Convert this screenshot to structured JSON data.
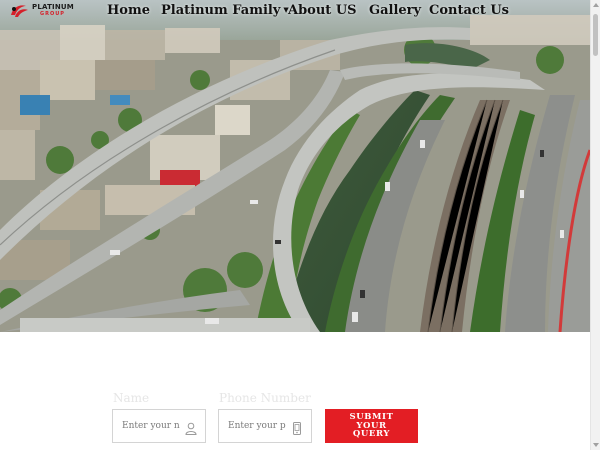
{
  "brand": {
    "name_line1": "PLATINUM",
    "name_line2": "GROUP",
    "accent_color": "#e31e24"
  },
  "nav": {
    "items": [
      {
        "label": "Home",
        "has_dropdown": false
      },
      {
        "label": "Platinum Family",
        "has_dropdown": true
      },
      {
        "label": "About US",
        "has_dropdown": false
      },
      {
        "label": "Gallery",
        "has_dropdown": false
      },
      {
        "label": "Contact Us",
        "has_dropdown": false
      }
    ],
    "dropdown_icon": "chevron-down-icon"
  },
  "hero": {
    "image_subject": "aerial view of city flyover, canal and railway"
  },
  "form": {
    "name_label": "Name",
    "name_placeholder": "Enter your name",
    "name_icon": "user-icon",
    "phone_label": "Phone Number",
    "phone_placeholder": "Enter your phone",
    "phone_icon": "phone-icon",
    "submit_lines": [
      "SUBMIT",
      "YOUR",
      "QUERY"
    ]
  }
}
